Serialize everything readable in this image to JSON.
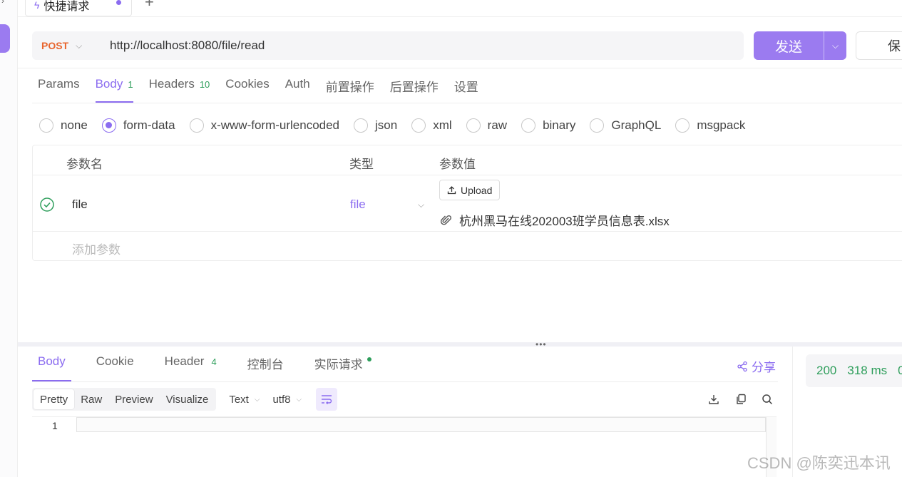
{
  "tab": {
    "title": "快捷请求"
  },
  "request": {
    "method": "POST",
    "url": "http://localhost:8080/file/read",
    "send_label": "发送",
    "save_label": "保"
  },
  "request_tabs": [
    {
      "label": "Params",
      "badge": ""
    },
    {
      "label": "Body",
      "badge": "1"
    },
    {
      "label": "Headers",
      "badge": "10"
    },
    {
      "label": "Cookies",
      "badge": ""
    },
    {
      "label": "Auth",
      "badge": ""
    },
    {
      "label": "前置操作",
      "badge": ""
    },
    {
      "label": "后置操作",
      "badge": ""
    },
    {
      "label": "设置",
      "badge": ""
    }
  ],
  "body_types": [
    "none",
    "form-data",
    "x-www-form-urlencoded",
    "json",
    "xml",
    "raw",
    "binary",
    "GraphQL",
    "msgpack"
  ],
  "body_type_selected": "form-data",
  "params_table": {
    "headers": {
      "name": "参数名",
      "type": "类型",
      "value": "参数值"
    },
    "row": {
      "name": "file",
      "type": "file",
      "upload_label": "Upload",
      "file_name": "杭州黑马在线202003班学员信息表.xlsx"
    },
    "add_placeholder": "添加参数"
  },
  "response_tabs": [
    {
      "label": "Body",
      "badge": ""
    },
    {
      "label": "Cookie",
      "badge": ""
    },
    {
      "label": "Header",
      "badge": "4"
    },
    {
      "label": "控制台",
      "badge": ""
    },
    {
      "label": "实际请求",
      "badge": ""
    }
  ],
  "share_label": "分享",
  "view_modes": [
    "Pretty",
    "Raw",
    "Preview",
    "Visualize"
  ],
  "format": "Text",
  "encoding": "utf8",
  "editor": {
    "line_number": "1"
  },
  "status": {
    "code": "200",
    "time": "318 ms",
    "extra": "0"
  },
  "watermark": "CSDN @陈奕迅本讯",
  "colors": {
    "accent": "#8b6cf0",
    "method": "#e8652e",
    "success": "#2e9e5b"
  }
}
